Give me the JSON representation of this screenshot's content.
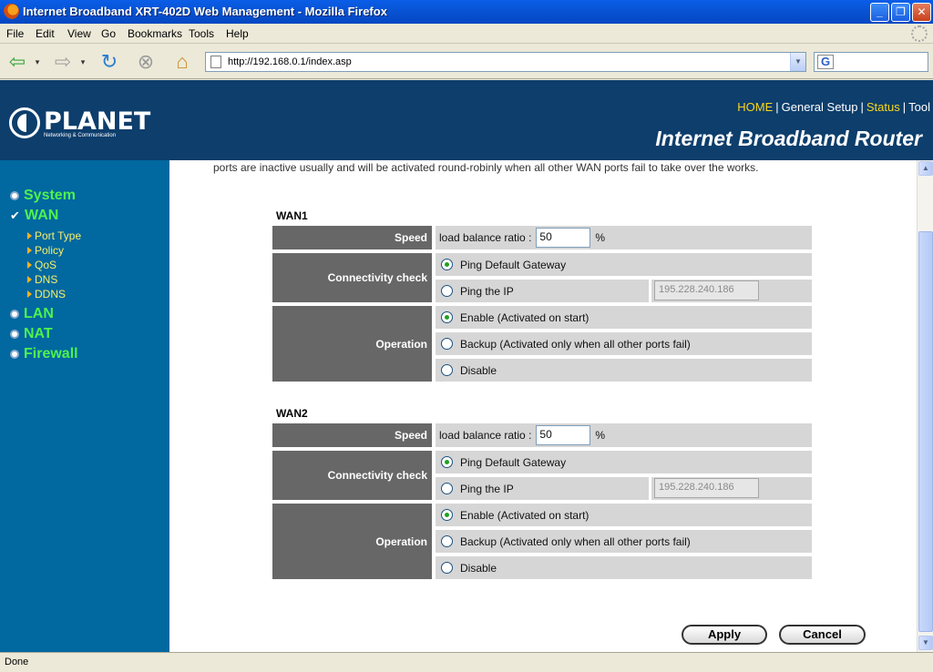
{
  "window": {
    "title": "Internet Broadband XRT-402D Web Management - Mozilla Firefox",
    "minimize": "_",
    "maximize": "❐",
    "close": "✕"
  },
  "menu": [
    "File",
    "Edit",
    "View",
    "Go",
    "Bookmarks",
    "Tools",
    "Help"
  ],
  "toolbar": {
    "url": "http://192.168.0.1/index.asp",
    "back_icon": "back-arrow-icon",
    "forward_icon": "forward-arrow-icon",
    "reload_icon": "reload-icon",
    "stop_icon": "stop-icon",
    "home_icon": "home-icon",
    "search_engine_letter": "G"
  },
  "header": {
    "brand": "PLANET",
    "tagline": "Networking & Communication",
    "nav": [
      "HOME",
      "General Setup",
      "Status",
      "Tool"
    ],
    "title": "Internet Broadband Router"
  },
  "sidebar": {
    "items": [
      {
        "label": "System"
      },
      {
        "label": "WAN",
        "checked": true
      },
      {
        "label": "LAN"
      },
      {
        "label": "NAT"
      },
      {
        "label": "Firewall"
      }
    ],
    "wan_sub": [
      "Port Type",
      "Policy",
      "QoS",
      "DNS",
      "DDNS"
    ]
  },
  "content": {
    "intro": "ports are inactive usually and will be activated round-robinly when all other WAN ports fail to take over the works.",
    "wans": [
      {
        "title": "WAN1",
        "speed_label": "Speed",
        "ratio_label": "load balance ratio :",
        "ratio_value": "50",
        "ratio_unit": "%",
        "conn_label": "Connectivity check",
        "ping_gw": "Ping Default Gateway",
        "ping_ip": "Ping the IP",
        "ip_value": "195.228.240.186",
        "op_label": "Operation",
        "op_enable": "Enable (Activated on start)",
        "op_backup": "Backup (Activated only when all other ports fail)",
        "op_disable": "Disable"
      },
      {
        "title": "WAN2",
        "speed_label": "Speed",
        "ratio_label": "load balance ratio :",
        "ratio_value": "50",
        "ratio_unit": "%",
        "conn_label": "Connectivity check",
        "ping_gw": "Ping Default Gateway",
        "ping_ip": "Ping the IP",
        "ip_value": "195.228.240.186",
        "op_label": "Operation",
        "op_enable": "Enable (Activated on start)",
        "op_backup": "Backup (Activated only when all other ports fail)",
        "op_disable": "Disable"
      }
    ],
    "apply": "Apply",
    "cancel": "Cancel"
  },
  "status": "Done"
}
